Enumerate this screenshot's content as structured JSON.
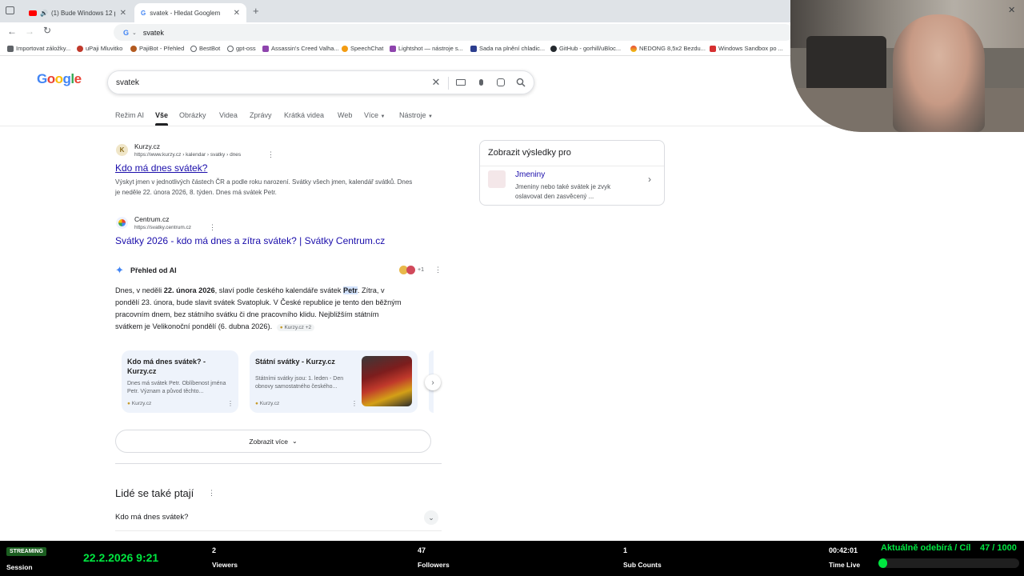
{
  "browser": {
    "tabs": [
      {
        "title": "(1) Bude Windows 12 pohá…",
        "active": false
      },
      {
        "title": "svatek - Hledat Googlem",
        "active": true
      }
    ],
    "address": "svatek",
    "bookmarks": [
      "Importovat záložky...",
      "uPaji Mluvitko",
      "PajiBot - Přehled",
      "BestBot",
      "gpt-oss",
      "Assassin's Creed Valha...",
      "SpeechChat",
      "Lightshot — nástroje s...",
      "Sada na plnění chladic...",
      "GitHub - gorhill/uBloc...",
      "NEDONG 8,5x2 Bezdu...",
      "Windows Sandbox po ..."
    ]
  },
  "google": {
    "logo": "Google",
    "query": "svatek",
    "nav_tabs": [
      "Režim AI",
      "Vše",
      "Obrázky",
      "Videa",
      "Zprávy",
      "Krátká videa",
      "Web",
      "Více",
      "Nástroje"
    ],
    "results": [
      {
        "site": "Kurzy.cz",
        "url": "https://www.kurzy.cz › kalendar › svatky › dnes",
        "title": "Kdo má dnes svátek?",
        "snippet_1": "Výskyt jmen v jednotlivých částech ČR a podle roku narození. Svátky všech jmen, kalendář svátků. Dnes",
        "snippet_2": "je neděle 22. února 2026, 8. týden. Dnes má svátek Petr."
      },
      {
        "site": "Centrum.cz",
        "url": "https://svatky.centrum.cz",
        "title": "Svátky 2026 - kdo má dnes a zítra svátek? | Svátky Centrum.cz"
      }
    ],
    "ai_overview": {
      "label": "Přehled od AI",
      "badge": "+1",
      "text_a": "Dnes, v neděli ",
      "text_b": "22. února 2026",
      "text_c": ", slaví podle českého kalendáře svátek ",
      "text_d": "Petr",
      "text_e": ". Zítra, v",
      "line_2": "pondělí 23. února, bude slavit svátek Svatopluk. V České republice je tento den běžným",
      "line_3": "pracovním dnem, bez státního svátku či dne pracovního klidu. Nejbližším státním",
      "line_4": "svátkem je Velikonoční pondělí (6. dubna 2026).",
      "source_chip": "Kurzy.cz +2",
      "cards": [
        {
          "title": "Kdo má dnes svátek? - Kurzy.cz",
          "snippet": "Dnes má svátek Petr. Oblíbenost jména Petr. Význam a původ těchto...",
          "source": "Kurzy.cz"
        },
        {
          "title": "Státní svátky - Kurzy.cz",
          "snippet": "Státními svátky jsou: 1. leden - Den obnovy samostatného českého...",
          "source": "Kurzy.cz"
        }
      ],
      "show_more": "Zobrazit více"
    },
    "people_also_ask": {
      "heading": "Lidé se také ptají",
      "questions": [
        "Kdo má dnes svátek?"
      ]
    },
    "side_panel": {
      "heading": "Zobrazit výsledky pro",
      "item_title": "Jmeniny",
      "item_desc": "Jmeniny nebo také svátek je zvyk oslavovat den zasvěcený ..."
    }
  },
  "stream": {
    "badge": "STREAMING",
    "session_label": "Session",
    "datetime": "22.2.2026 9:21",
    "viewers_value": "2",
    "viewers_label": "Viewers",
    "followers_value": "47",
    "followers_label": "Followers",
    "subs_value": "1",
    "subs_label": "Sub Counts",
    "time_value": "00:42:01",
    "time_label": "Time Live",
    "goal_text": "Aktuálně odebírá / Cíl",
    "goal_count": "47 / 1000",
    "goal_progress": 0.047
  },
  "colors": {
    "link": "#1a0dab",
    "stream_green": "#00e640",
    "google_blue": "#4285f4",
    "google_red": "#ea4335",
    "google_yellow": "#fbbc05",
    "google_green": "#34a853"
  }
}
